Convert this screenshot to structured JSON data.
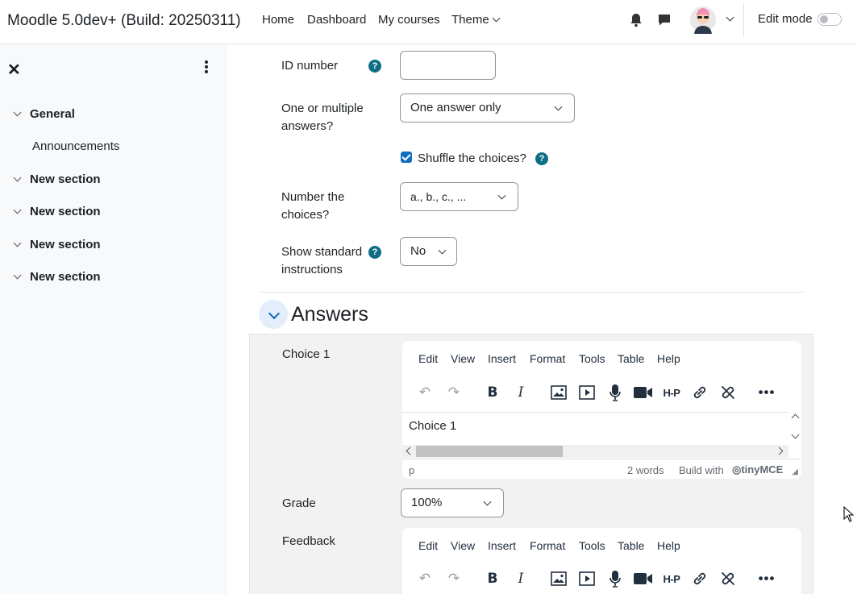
{
  "navbar": {
    "brand": "Moodle 5.0dev+ (Build: 20250311)",
    "links": [
      "Home",
      "Dashboard",
      "My courses",
      "Theme"
    ],
    "edit_mode_label": "Edit mode"
  },
  "sidebar": {
    "sections": [
      {
        "label": "General"
      },
      {
        "label": "New section"
      },
      {
        "label": "New section"
      },
      {
        "label": "New section"
      },
      {
        "label": "New section"
      }
    ],
    "sub_items": [
      {
        "label": "Announcements"
      }
    ]
  },
  "form": {
    "id_number_label": "ID number",
    "multiple_label_line1": "One or multiple",
    "multiple_label_line2": "answers?",
    "multiple_value": "One answer only",
    "shuffle_label": "Shuffle the choices?",
    "number_label_line1": "Number the",
    "number_label_line2": "choices?",
    "number_value": "a., b., c., ...",
    "instructions_label_line1": "Show standard",
    "instructions_label_line2": "instructions",
    "instructions_value": "No",
    "help_glyph": "?"
  },
  "answers": {
    "heading": "Answers",
    "choice_label": "Choice 1",
    "grade_label": "Grade",
    "grade_value": "100%",
    "feedback_label": "Feedback"
  },
  "editor": {
    "menu": [
      "Edit",
      "View",
      "Insert",
      "Format",
      "Tools",
      "Table",
      "Help"
    ],
    "content": "Choice 1",
    "status_path": "p",
    "word_count": "2 words",
    "build_with": "Build with",
    "tinymce": "tinyMCE"
  },
  "colors": {
    "accent": "#0f6cbf",
    "help": "#0f6e85",
    "sidebar_bg": "#f8f9fa",
    "answer_bg": "#f2f2f2"
  }
}
